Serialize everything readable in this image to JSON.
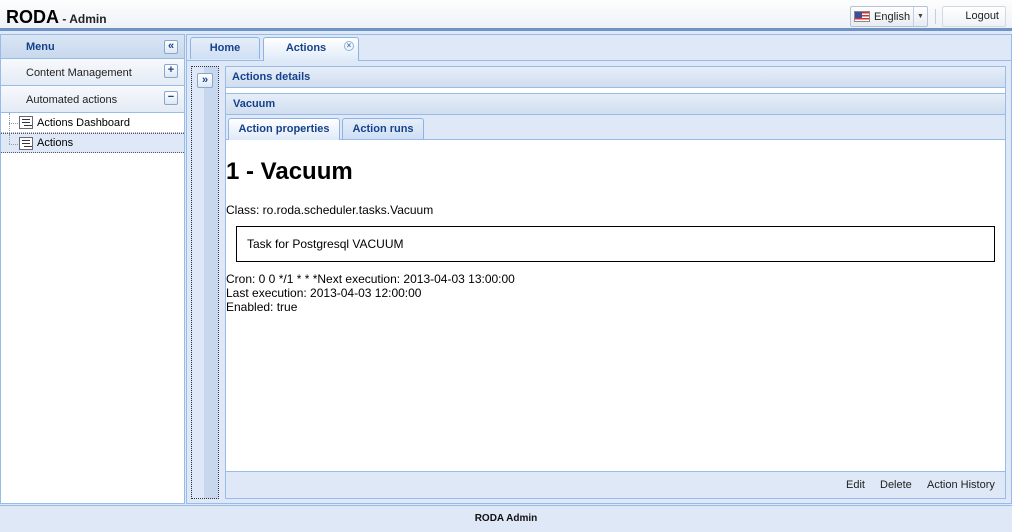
{
  "header": {
    "brand": "RODA",
    "brand_sub": " - Admin",
    "language": "English",
    "logout": "Logout"
  },
  "sidebar": {
    "menu_title": "Menu",
    "sections": [
      {
        "label": "Content Management",
        "tool": "+"
      },
      {
        "label": "Automated actions",
        "tool": "−"
      }
    ],
    "tree_items": [
      {
        "label": "Actions Dashboard"
      },
      {
        "label": "Actions"
      }
    ]
  },
  "tabs": {
    "home": "Home",
    "actions": "Actions"
  },
  "panel": {
    "title": "Actions details",
    "inner_title": "Vacuum",
    "subtab_props": "Action properties",
    "subtab_runs": "Action runs"
  },
  "action": {
    "title": "1 - Vacuum",
    "class_line": "Class: ro.roda.scheduler.tasks.Vacuum",
    "description": "Task for Postgresql VACUUM",
    "cron_line": "Cron: 0 0 */1 * * *Next execution: 2013-04-03 13:00:00",
    "last_line": "Last execution: 2013-04-03 12:00:00",
    "enabled_line": "Enabled: true"
  },
  "footer_buttons": {
    "edit": "Edit",
    "delete": "Delete",
    "history": "Action History"
  },
  "app_footer": "RODA Admin"
}
